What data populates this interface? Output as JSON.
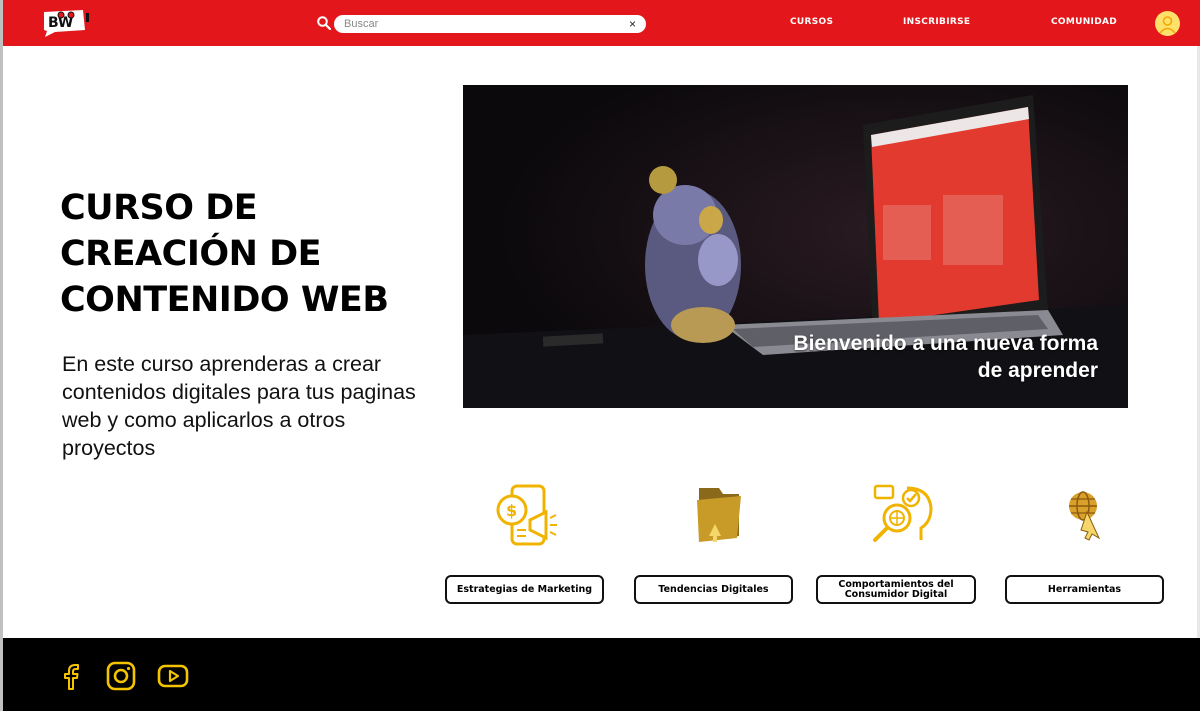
{
  "header": {
    "logo_alt": "BW",
    "search": {
      "placeholder": "Buscar",
      "value": "",
      "clear_label": "×"
    },
    "nav": [
      {
        "label": "CURSOS"
      },
      {
        "label": "INSCRIBIRSE"
      },
      {
        "label": "COMUNIDAD"
      }
    ],
    "brand_color": "#e3171b",
    "avatar_color": "#ffe06a"
  },
  "hero": {
    "title": "CURSO DE\nCREACIÓN DE\nCONTENIDO WEB",
    "description": "En este curso aprenderas a crear contenidos digitales para tus paginas web y como aplicarlos a otros proyectos",
    "image_caption": "Bienvenido a una nueva forma\nde aprender"
  },
  "categories": [
    {
      "label": "Estrategias de Marketing",
      "icon": "marketing-icon"
    },
    {
      "label": "Tendencias Digitales",
      "icon": "folder-icon"
    },
    {
      "label": "Comportamientos del\nConsumidor Digital",
      "icon": "consumer-behavior-icon"
    },
    {
      "label": "Herramientas",
      "icon": "globe-cursor-icon"
    }
  ],
  "footer": {
    "social": [
      {
        "name": "facebook-icon"
      },
      {
        "name": "instagram-icon"
      },
      {
        "name": "youtube-icon"
      }
    ],
    "icon_color": "#f5c400"
  }
}
